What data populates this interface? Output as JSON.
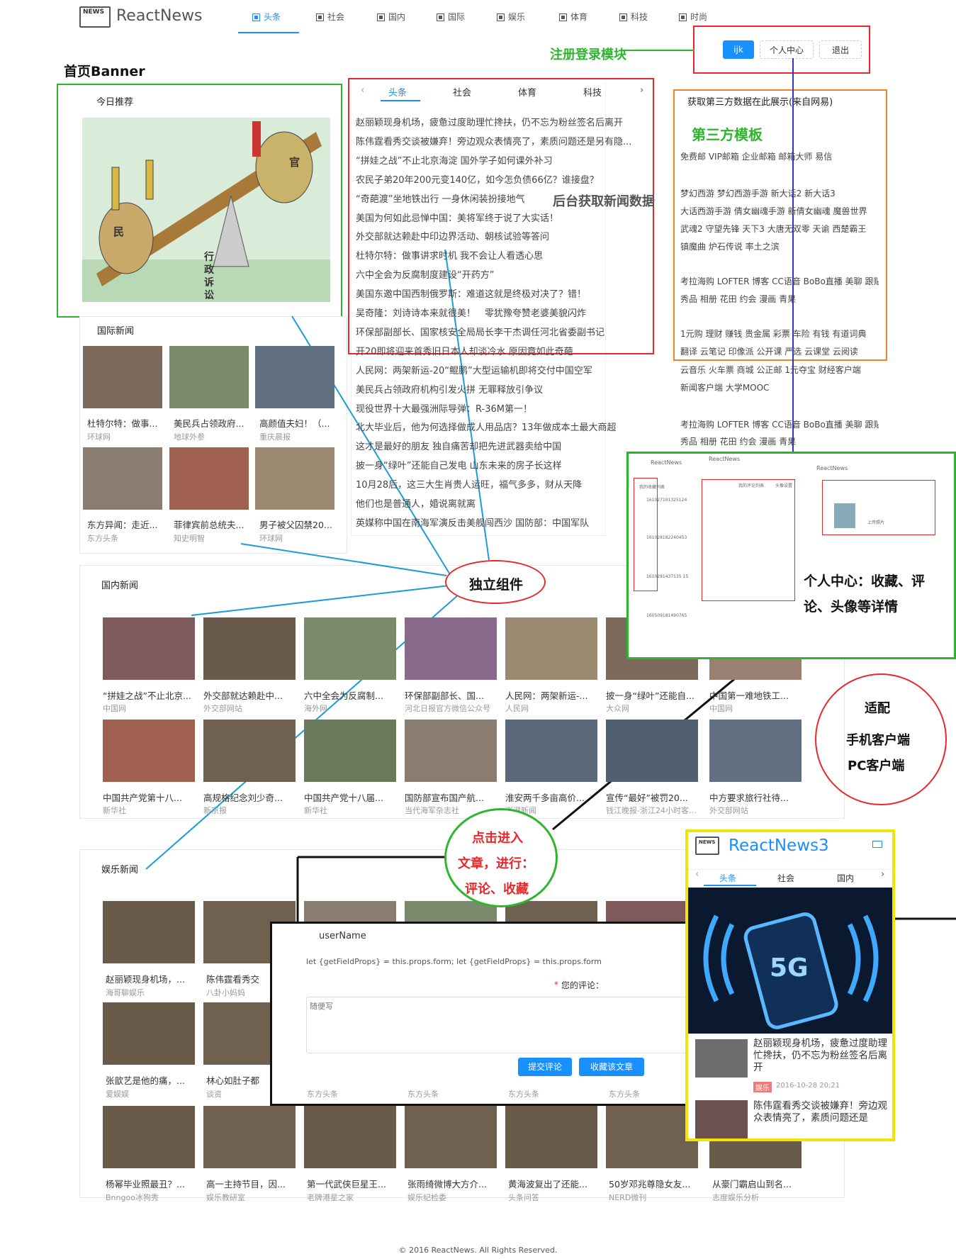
{
  "header": {
    "logo_badge": "NEWS",
    "logo_text": "ReactNews",
    "nav": [
      "头条",
      "社会",
      "国内",
      "国际",
      "娱乐",
      "体育",
      "科技",
      "时尚"
    ],
    "user_button": "ijk",
    "center_button": "个人中心",
    "logout_button": "退出"
  },
  "annotations": {
    "banner": "首页Banner",
    "login": "注册登录模块",
    "third_party": "第三方模板",
    "backend": "后台获取新闻数据",
    "component": "独立组件",
    "center": "个人中心：收藏、评论、头像等详情",
    "adapt": [
      "适配",
      "手机客户端",
      "PC客户端"
    ],
    "click": [
      "点击进入",
      "文章，进行：",
      "评论、收藏"
    ]
  },
  "banner": {
    "title": "今日推荐",
    "cartoon_labels": [
      "民",
      "官",
      "行",
      "政",
      "诉",
      "讼"
    ]
  },
  "tabs_panel": {
    "tabs": [
      "头条",
      "社会",
      "体育",
      "科技"
    ],
    "news": [
      "赵丽颖现身机场，疲惫过度助理忙搀扶，仍不忘为粉丝签名后离开",
      "陈伟霆看秀交谈被嫌弃！旁边观众表情亮了，素质问题还是另有隐...",
      "“拼娃之战”不止北京海淀 国外学子如何课外补习",
      "农民子弟20年200元变140亿，如今怎负债66亿？谁接盘？",
      "“奇葩渡”坐地铁出行 一身休闲装扮接地气",
      "美国为何如此忌惮中国：美将军终于说了大实话！",
      "外交部就达赖赴中印边界活动、朝核试验等答问",
      "杜特尔特：做事讲求时机 我不会让人看透心思",
      "六中全会为反腐制度建设“开药方”",
      "美国东邀中国西制俄罗斯：难道这就是终极对决了？错！",
      "吴奇隆：刘诗诗本来就很美！　零犹豫夸赞老婆美貌闪炸",
      "环保部副部长、国家核安全局局长李干杰调任河北省委副书记",
      "开20即将迎来首秀旧日本人却淡冷水 原因竟如此奇葩",
      "人民网：两架新运-20“鲲鹏”大型运输机即将交付中国空军",
      "美民兵占领政府机构引发火拼 无罪释放引争议",
      "现役世界十大最强洲际导弹：R-36M第一！",
      "北大毕业后，他为何选择做成人用品店？13年做成本土最大商超",
      "这才是最好的朋友 独自痛苦却把先进武器卖给中国",
      "披一身“绿叶”还能自己发电 山东未来的房子长这样",
      "10月28后，这三大生肖贵人运旺，福气多多，财从天降",
      "他们也是普通人，婚说离就离",
      "英媒称中国在南海军演反击美舰闯西沙 国防部：中国军队"
    ]
  },
  "third_party": {
    "title": "获取第三方数据在此展示(来自网易)",
    "rows": [
      "免费邮 VIP邮箱 企业邮箱 邮箱大师 易信",
      "梦幻西游 梦幻西游手游 新大话2 新大话3",
      "大话西游手游 倩女幽魂手游 新倩女幽魂 魔兽世界",
      "武魂2 守望先锋 天下3 大唐无双零 天谕 西楚霸王",
      "镇魔曲 炉石传说 率土之滨",
      "考拉海购 LOFTER 博客 CC语音 BoBo直播 美聊 跟贴",
      "秀品 相册 花田 约会 漫画 青果",
      "1元购 理财 赚钱 贵金属 彩票 车险 有钱 有道词典",
      "翻译 云笔记 印像派 公开课 严选 云课堂 云阅读",
      "云音乐 火车票 商城 公正邮 1元夺宝 财经客户端",
      "新闻客户端 大学MOOC",
      "考拉海购 LOFTER 博客 CC语音 BoBo直播 美聊 跟贴",
      "秀品 相册 花田 约会 漫画 青果"
    ]
  },
  "intl_news": {
    "title": "国际新闻",
    "items": [
      {
        "cap": "杜特尔特：做事...",
        "src": "环球网"
      },
      {
        "cap": "美民兵占领政府...",
        "src": "地球外参"
      },
      {
        "cap": "高颜值夫妇！（...",
        "src": "重庆晨报"
      },
      {
        "cap": "东方异闻：走近...",
        "src": "东方头条"
      },
      {
        "cap": "菲律宾前总统夫...",
        "src": "知史明智"
      },
      {
        "cap": "男子被父囚禁20...",
        "src": "环球网"
      }
    ]
  },
  "domestic": {
    "title": "国内新闻",
    "items": [
      {
        "cap": "“拼娃之战”不止北京...",
        "src": "中国网"
      },
      {
        "cap": "外交部就达赖赴中...",
        "src": "外交部网站"
      },
      {
        "cap": "六中全会为反腐制...",
        "src": "海外网"
      },
      {
        "cap": "环保部副部长、国...",
        "src": "河北日报官方微信公众号"
      },
      {
        "cap": "人民网：两架新运-...",
        "src": "人民网"
      },
      {
        "cap": "披一身“绿叶”还能自...",
        "src": "大众网"
      },
      {
        "cap": "中国第一难地铁工...",
        "src": "中国网"
      },
      {
        "cap": "中国共产党第十八...",
        "src": "新华社"
      },
      {
        "cap": "高规格纪念刘少奇...",
        "src": "新京报"
      },
      {
        "cap": "中国共产党十八届...",
        "src": "新华社"
      },
      {
        "cap": "国防部宣布国产航...",
        "src": "当代海军杂志社"
      },
      {
        "cap": "淮安两千多亩高价...",
        "src": "澎湃新闻"
      },
      {
        "cap": "宣传“最好”被罚20...",
        "src": "钱江晚报-浙江24小时客户端"
      },
      {
        "cap": "中方要求旅行社待...",
        "src": "外交部网站"
      }
    ]
  },
  "ent": {
    "title": "娱乐新闻",
    "items": [
      {
        "cap": "赵丽颖现身机场，...",
        "src": "海哥聊娱乐"
      },
      {
        "cap": "陈伟霆看秀交",
        "src": "八卦小妈妈"
      },
      {
        "cap": "张歆艺是他的痛，...",
        "src": "爱娱娱"
      },
      {
        "cap": "林心如肚子都",
        "src": "谈资"
      },
      {
        "cap": "杨幂毕业照最丑？...",
        "src": "Bnngoo冰狗秀"
      },
      {
        "cap": "高一主持节目，因...",
        "src": "娱乐教研室"
      },
      {
        "cap": "第一代武侠巨星王...",
        "src": "老牌港星之家"
      },
      {
        "cap": "张雨绮微博大方介...",
        "src": "娱乐纪检委"
      },
      {
        "cap": "黄海波复出了还能...",
        "src": "头条问答"
      },
      {
        "cap": "50岁邓兆尊隐女友...",
        "src": "NERD微刊"
      },
      {
        "cap": "从豪门霸启山到名...",
        "src": "志度娱乐分析"
      }
    ],
    "row2_src": [
      "东方头条",
      "东方头条",
      "东方头条",
      "东方头条"
    ]
  },
  "comment": {
    "user": "userName",
    "code": "let {getFieldProps} = this.props.form; let {getFieldProps} = this.props.form",
    "label": "您的评论：",
    "required": "*",
    "placeholder": "随便写",
    "submit": "提交评论",
    "collect": "收藏该文章"
  },
  "center_shot": {
    "logo": "ReactNews",
    "tabs": [
      "我的收藏列表",
      "我的评论列表",
      "头像设置"
    ],
    "ids": [
      "161027191325124",
      "161028182240453",
      "1610281437535 15",
      "160509181490765"
    ],
    "upload": "上传照片"
  },
  "mobile": {
    "title": "ReactNews3",
    "tabs": [
      "头条",
      "社会",
      "国内"
    ],
    "news1": "赵丽颖现身机场，疲惫过度助理忙搀扶，仍不忘为粉丝签名后离开",
    "tag": "娱乐",
    "date": "2016-10-28 20:21",
    "news2": "陈伟霆看秀交谈被嫌弃！旁边观众表情亮了，素质问题还是"
  },
  "footer": "© 2016 ReactNews. All Rights Reserved."
}
